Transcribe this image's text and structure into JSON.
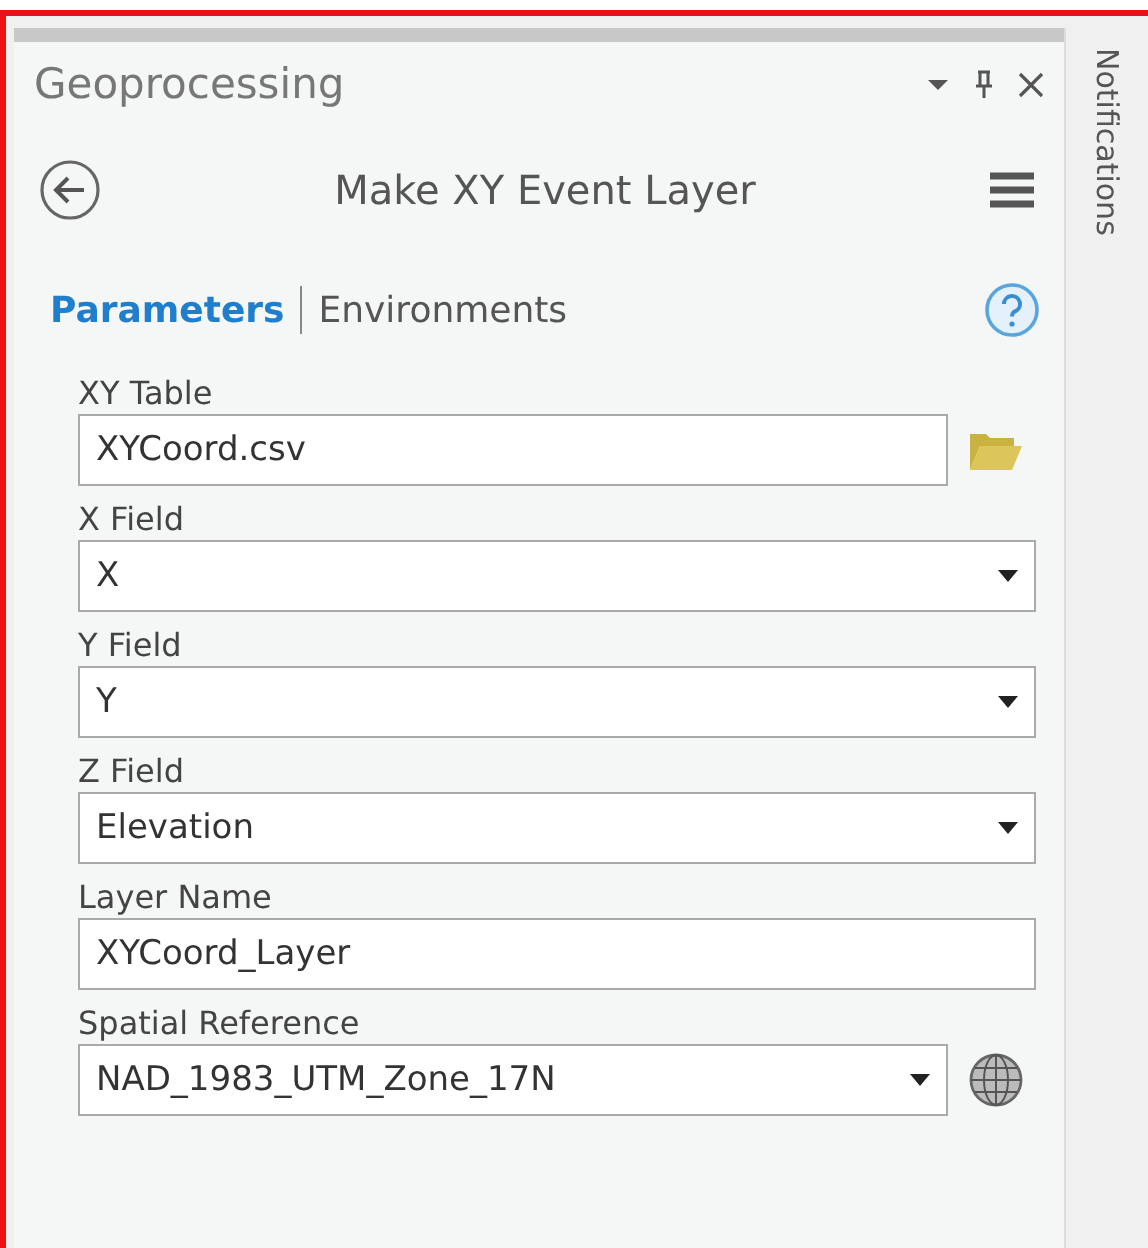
{
  "pane": {
    "title": "Geoprocessing",
    "notifications_tab": "Notifications"
  },
  "tool": {
    "title": "Make XY Event Layer"
  },
  "tabs": [
    {
      "label": "Parameters",
      "selected": true
    },
    {
      "label": "Environments",
      "selected": false
    }
  ],
  "parameters": [
    {
      "kind": "file",
      "label": "XY Table",
      "value": "XYCoord.csv"
    },
    {
      "kind": "dropdown",
      "label": "X Field",
      "value": "X"
    },
    {
      "kind": "dropdown",
      "label": "Y Field",
      "value": "Y"
    },
    {
      "kind": "dropdown",
      "label": "Z Field",
      "value": "Elevation"
    },
    {
      "kind": "text",
      "label": "Layer Name",
      "value": "XYCoord_Layer"
    },
    {
      "kind": "coordinate",
      "label": "Spatial Reference",
      "value": "NAD_1983_UTM_Zone_17N"
    }
  ]
}
